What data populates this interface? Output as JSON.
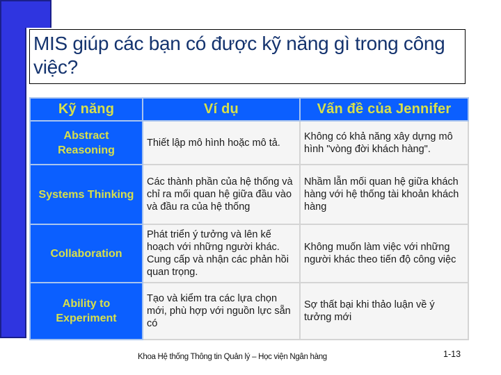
{
  "slide": {
    "title": "MIS giúp các bạn có được kỹ năng gì trong công việc?",
    "colors": {
      "accent_bar": "#2f35e0",
      "table_header_bg": "#0b5fff",
      "table_header_text": "#d8e04a",
      "title_text": "#14336e",
      "cell_bg": "#f5f5f5"
    }
  },
  "table": {
    "headers": [
      "Kỹ năng",
      "Ví dụ",
      "Vấn đề của Jennifer"
    ],
    "rows": [
      {
        "skill": "Abstract Reasoning",
        "example": "Thiết lập mô hình hoặc mô tả.",
        "problem": "Không có khả năng xây dựng mô hình \"vòng đời khách hàng\"."
      },
      {
        "skill": "Systems Thinking",
        "example": "Các thành phần của hệ thống và chỉ ra mối quan hệ giữa đầu vào và đầu ra của hệ thống",
        "problem": "Nhầm lẫn mối quan hệ giữa khách hàng với hệ thống tài khoản khách hàng"
      },
      {
        "skill": "Collaboration",
        "example": "Phát triển ý tưởng và lên kế hoạch với những người khác. Cung cấp và nhận các phản hồi quan trọng.",
        "problem": "Không muốn làm việc với những người khác theo tiến độ công việc"
      },
      {
        "skill": "Ability to Experiment",
        "example": "Tạo và kiểm tra các lựa chọn mới, phù hợp với nguồn lực sẵn có",
        "problem": "Sợ thất bại khi thảo luận về ý tưởng mới"
      }
    ]
  },
  "footer": {
    "text": "Khoa Hệ thống Thông tin Quản lý – Học viện Ngân hàng",
    "page_number": "1-13"
  }
}
